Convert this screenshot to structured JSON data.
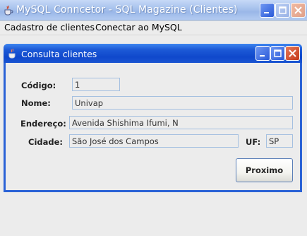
{
  "app": {
    "title": "MySQL Conncetor - SQL Magazine (Clientes)",
    "app_icon": "java-cup-icon"
  },
  "menubar": {
    "items": [
      "Cadastro de clientes",
      "Conectar ao MySQL"
    ]
  },
  "inner_window": {
    "title": "Consulta clientes",
    "icon": "java-cup-icon"
  },
  "form": {
    "codigo": {
      "label": "Código:",
      "value": "1"
    },
    "nome": {
      "label": "Nome:",
      "value": "Univap"
    },
    "endereco": {
      "label": "Endereço:",
      "value": "Avenida Shishima Ifumi, N"
    },
    "cidade": {
      "label": "Cidade:",
      "value": "São José dos Campos"
    },
    "uf": {
      "label": "UF:",
      "value": "SP"
    }
  },
  "buttons": {
    "next_label": "Proximo"
  },
  "colors": {
    "outer_titlebar": "#a6c1ec",
    "inner_titlebar": "#0f48cc",
    "background": "#ececec",
    "field_border": "#a5c0e0"
  }
}
